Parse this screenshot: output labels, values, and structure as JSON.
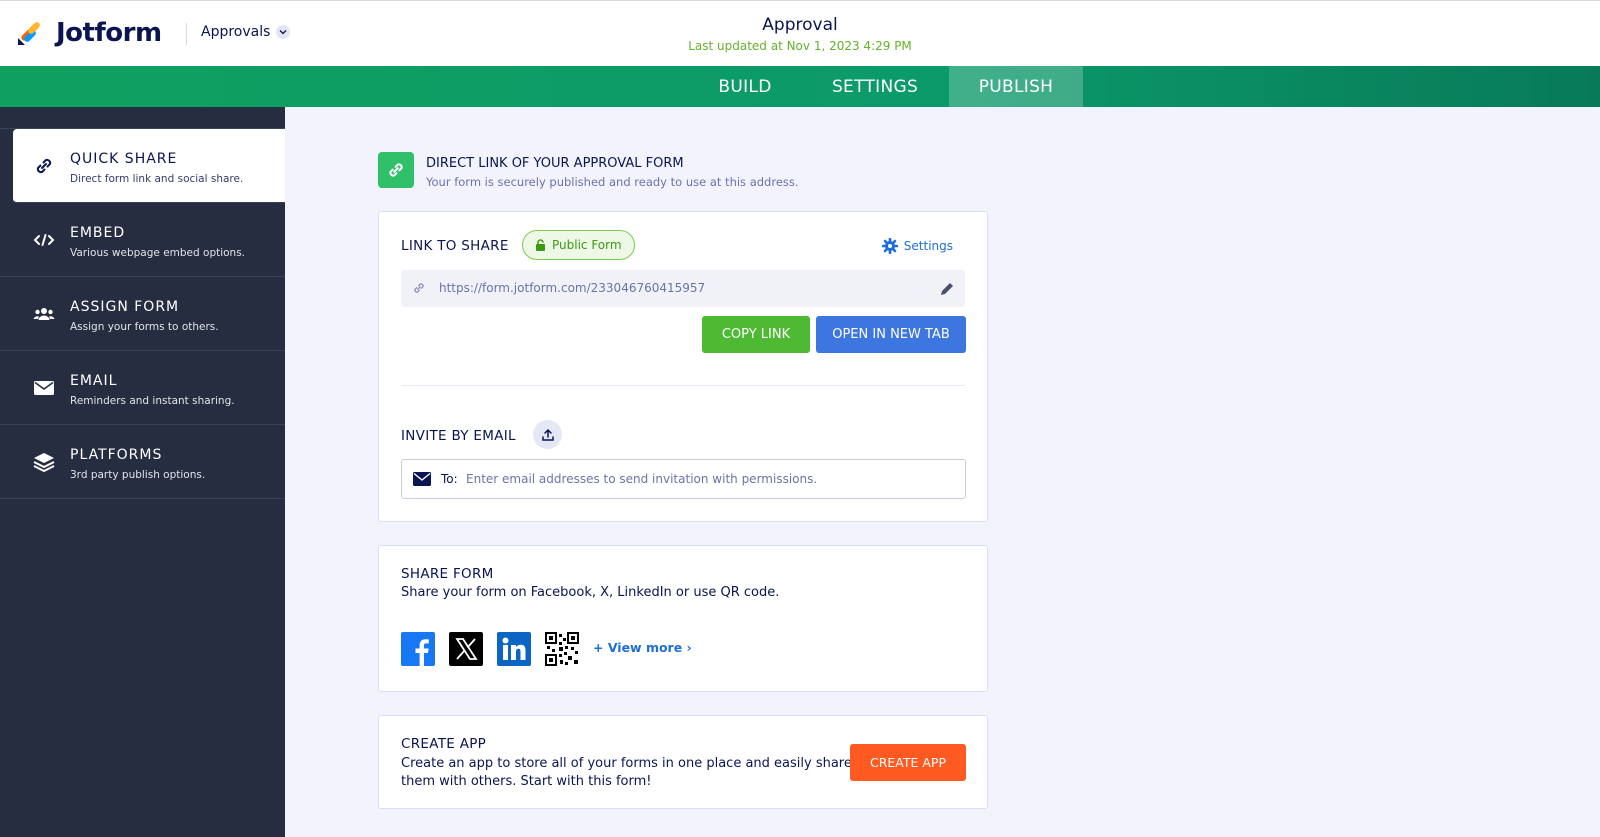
{
  "header": {
    "brand": "Jotform",
    "dropdown_label": "Approvals",
    "title": "Approval",
    "subtitle": "Last updated at Nov 1, 2023 4:29 PM"
  },
  "tabs": [
    {
      "label": "BUILD",
      "active": false
    },
    {
      "label": "SETTINGS",
      "active": false
    },
    {
      "label": "PUBLISH",
      "active": true
    }
  ],
  "sidebar": {
    "items": [
      {
        "title": "QUICK SHARE",
        "desc": "Direct form link and social share.",
        "icon": "link-icon",
        "active": true
      },
      {
        "title": "EMBED",
        "desc": "Various webpage embed options.",
        "icon": "code-icon",
        "active": false
      },
      {
        "title": "ASSIGN FORM",
        "desc": "Assign your forms to others.",
        "icon": "users-icon",
        "active": false
      },
      {
        "title": "EMAIL",
        "desc": "Reminders and instant sharing.",
        "icon": "envelope-icon",
        "active": false
      },
      {
        "title": "PLATFORMS",
        "desc": "3rd party publish options.",
        "icon": "layers-icon",
        "active": false
      }
    ]
  },
  "direct_link": {
    "title": "DIRECT LINK OF YOUR APPROVAL FORM",
    "desc": "Your form is securely published and ready to use at this address."
  },
  "link_card": {
    "label": "LINK TO SHARE",
    "badge": "Public Form",
    "settings": "Settings",
    "url": "https://form.jotform.com/233046760415957",
    "copy_button": "COPY LINK",
    "open_button": "OPEN IN NEW TAB",
    "invite_label": "INVITE BY EMAIL",
    "to_label": "To:",
    "email_placeholder": "Enter email addresses to send invitation with permissions."
  },
  "share_card": {
    "title": "SHARE FORM",
    "desc": "Share your form on Facebook, X, LinkedIn or use QR code.",
    "view_more": "+ View more ›",
    "icons": [
      "facebook-icon",
      "x-icon",
      "linkedin-icon",
      "qr-code-icon"
    ]
  },
  "app_card": {
    "title": "CREATE APP",
    "desc_line1": "Create an app to store all of your forms in one place and easily share",
    "desc_line2": "them with others. Start with this form!",
    "button": "CREATE APP"
  },
  "colors": {
    "green_bar": "#0fa060",
    "sidebar": "#262d40",
    "copy": "#4eba34",
    "open": "#3e76e0",
    "create_app": "#ff5a22",
    "accent_link": "#1d6fd8"
  }
}
